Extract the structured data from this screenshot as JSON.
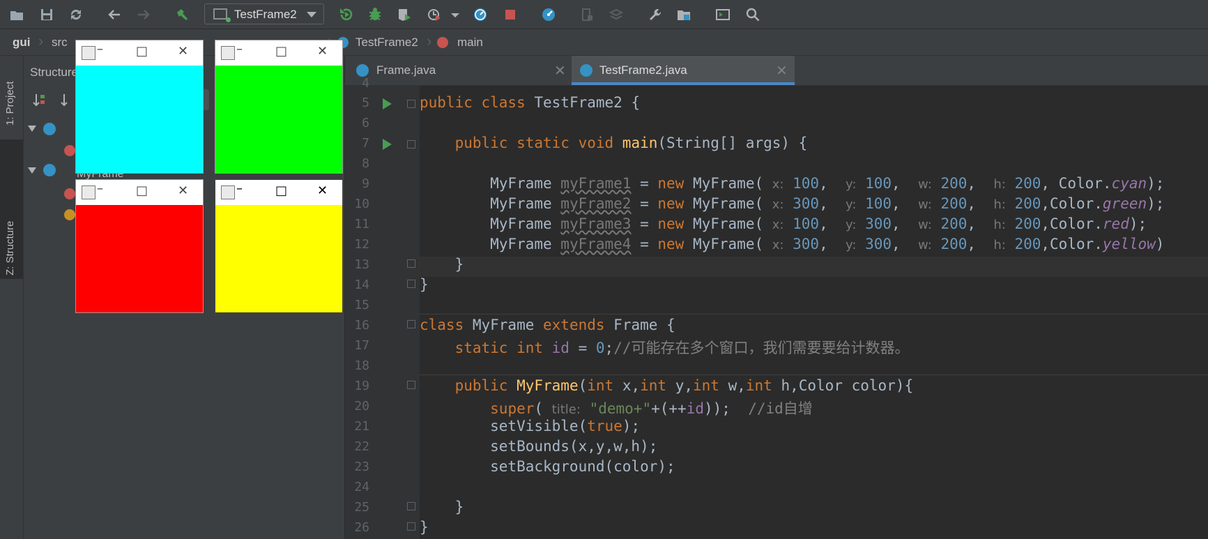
{
  "toolbar": {
    "run_config": "TestFrame2",
    "icons": [
      "open-folder-icon",
      "save-icon",
      "sync-icon",
      "back-icon",
      "forward-icon",
      "build-hammer-icon",
      "run-icon",
      "debug-icon",
      "coverage-icon",
      "profile-icon",
      "dropdown-icon",
      "stopwatch-icon",
      "stop-icon",
      "update-icon",
      "sdk-icon",
      "module-icon",
      "wrench-icon",
      "project-structure-icon",
      "terminal-icon",
      "search-icon"
    ]
  },
  "breadcrumb": [
    "gui",
    "src",
    "TestFrame2",
    "main"
  ],
  "left_tabs": [
    "1: Project",
    "Z: Structure"
  ],
  "structure": {
    "title": "Structure",
    "item": "MyFrame"
  },
  "tabs": [
    {
      "label": "Frame.java",
      "active": false
    },
    {
      "label": "TestFrame2.java",
      "active": true
    }
  ],
  "code": {
    "line_numbers": [
      "4",
      "5",
      "6",
      "7",
      "8",
      "9",
      "10",
      "11",
      "12",
      "13",
      "14",
      "15",
      "16",
      "17",
      "18",
      "19",
      "20",
      "21",
      "22",
      "23",
      "24",
      "25",
      "26"
    ]
  },
  "frames": [
    {
      "name": "cyan",
      "color": "#00ffff"
    },
    {
      "name": "green",
      "color": "#00ff00"
    },
    {
      "name": "red",
      "color": "#ff0000"
    },
    {
      "name": "yellow",
      "color": "#ffff00"
    }
  ],
  "colors": {
    "editor_bg": "#2b2b2b",
    "keyword": "#cc7832",
    "number": "#6897bb",
    "string": "#6a8759",
    "run_green": "#499c54"
  }
}
